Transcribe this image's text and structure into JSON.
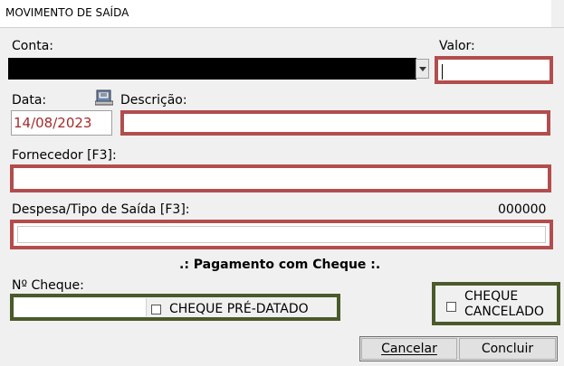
{
  "window": {
    "title": "MOVIMENTO DE SAÍDA"
  },
  "labels": {
    "conta": "Conta:",
    "valor": "Valor:",
    "data": "Data:",
    "descricao": "Descrição:",
    "fornecedor": "Fornecedor  [F3]:",
    "despesa": "Despesa/Tipo de Saída [F3]:",
    "despesa_code": "000000",
    "pagamento_header": ".: Pagamento com Cheque :.",
    "n_cheque": "Nº Cheque:",
    "cheque_pre_datado": "CHEQUE PRÉ-DATADO",
    "cheque_cancelado_line1": "CHEQUE",
    "cheque_cancelado_line2": "CANCELADO"
  },
  "fields": {
    "conta_value": "",
    "valor_value": "",
    "data_value": "14/08/2023",
    "descricao_value": "",
    "fornecedor_value": "",
    "despesa_value": "",
    "n_cheque_value": ""
  },
  "buttons": {
    "cancelar": "Cancelar",
    "concluir": "Concluir"
  },
  "icons": {
    "calendar": "calendar-picker-icon",
    "dropdown": "chevron-down-icon"
  },
  "colors": {
    "highlight_red": "#b34d4d",
    "highlight_green": "#4a5a2a",
    "date_text": "#a52a2a"
  }
}
